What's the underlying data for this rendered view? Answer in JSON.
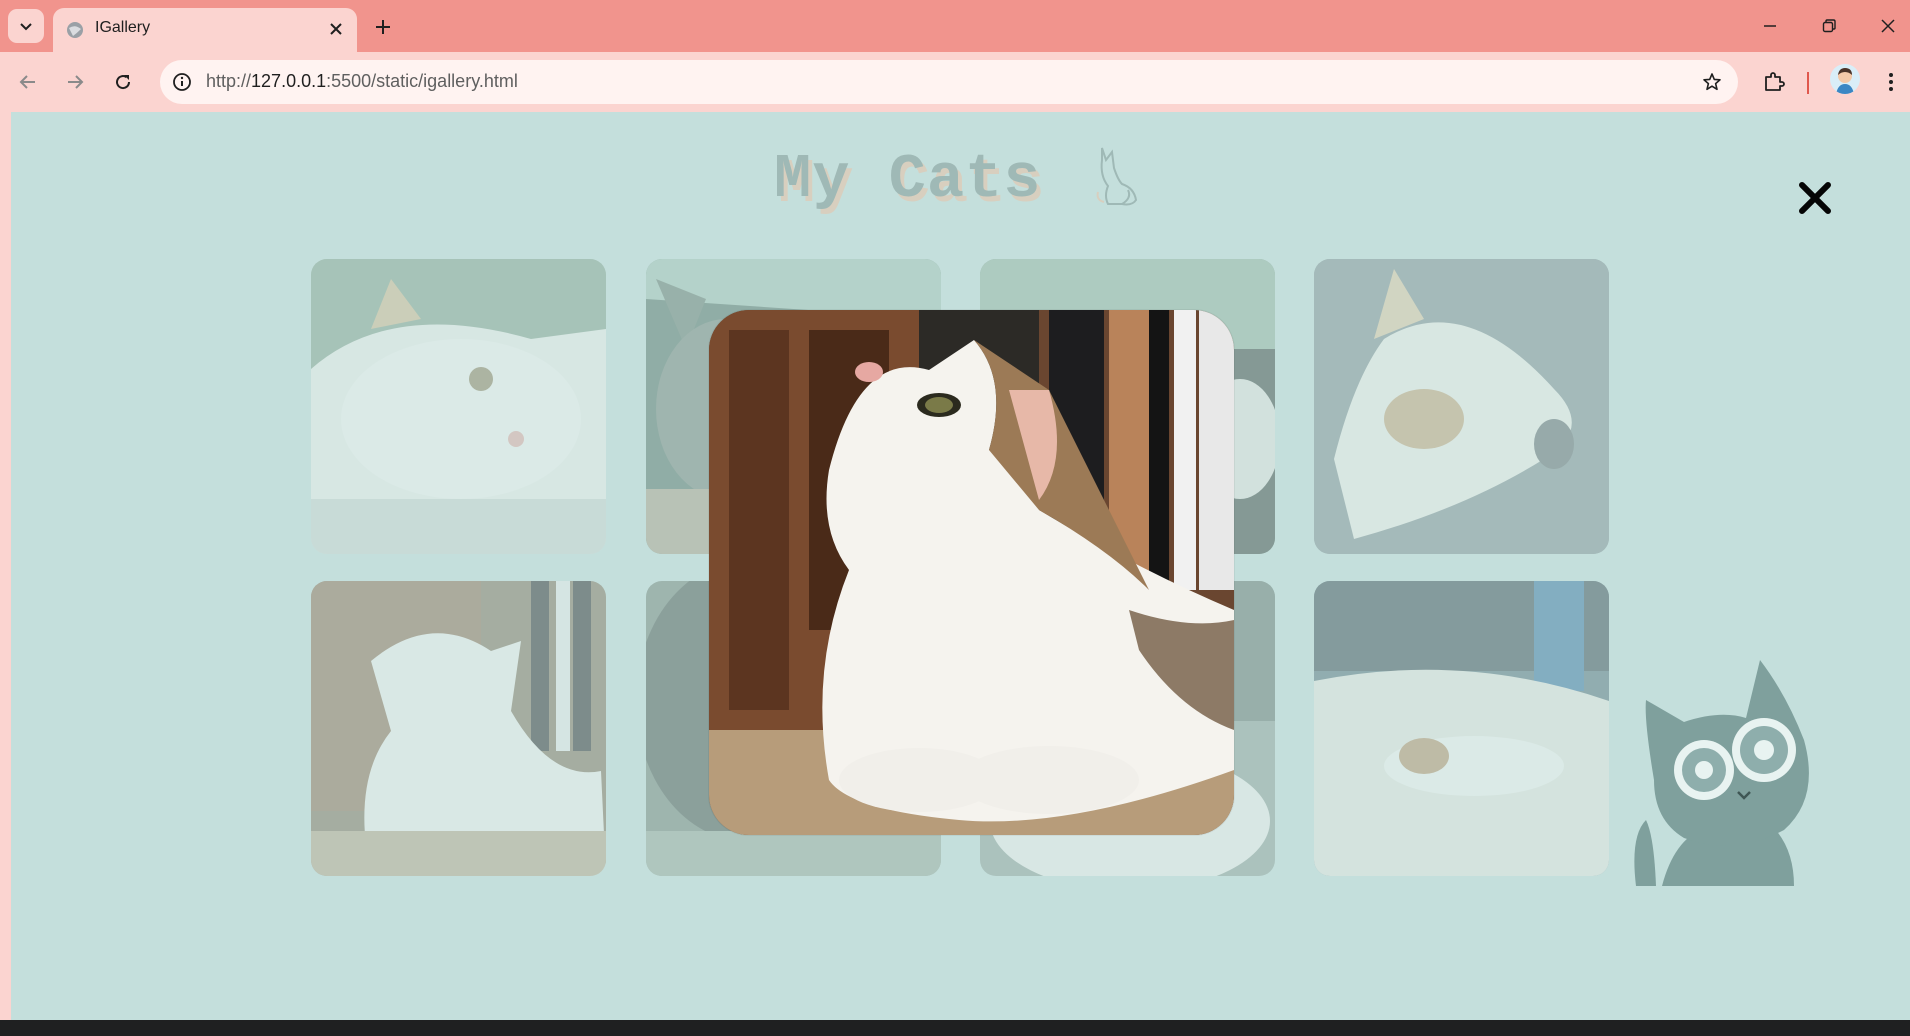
{
  "browser": {
    "tab_title": "IGallery",
    "url_prefix": "http://",
    "url_host": "127.0.0.1",
    "url_rest": ":5500/static/igallery.html",
    "icons": {
      "tab_search": "chevron-down-icon",
      "tab_favicon": "globe-icon",
      "tab_close": "close-icon",
      "new_tab": "plus-icon",
      "minimize": "minimize-icon",
      "restore": "restore-icon",
      "close": "close-icon",
      "back": "arrow-left-icon",
      "forward": "arrow-right-icon",
      "reload": "reload-icon",
      "site_info": "info-icon",
      "bookmark": "star-icon",
      "extensions": "puzzle-icon",
      "menu": "kebab-menu-icon"
    }
  },
  "page": {
    "title": "My Cats",
    "close_icon": "close-icon",
    "accent_background": "#c4dfdc",
    "title_color": "#9fb9b6",
    "gallery": {
      "photos": [
        {
          "subject": "cat lying sideways on bed",
          "position": "row1-col1"
        },
        {
          "subject": "cat near plants",
          "position": "row1-col2"
        },
        {
          "subject": "cat under table",
          "position": "row1-col3"
        },
        {
          "subject": "cat stretching on blanket",
          "position": "row1-col4"
        },
        {
          "subject": "cat looking up",
          "position": "row2-col1"
        },
        {
          "subject": "cat portrait",
          "position": "row2-col2"
        },
        {
          "subject": "cat paws",
          "position": "row2-col3"
        },
        {
          "subject": "cat sleeping on sheets",
          "position": "row2-col4"
        }
      ],
      "lightbox_open": true,
      "lightbox_photo_index": 5
    }
  }
}
